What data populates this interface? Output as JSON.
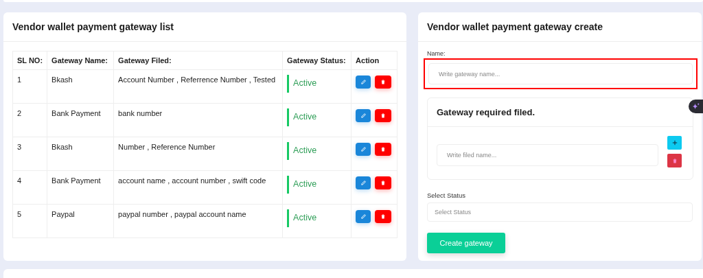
{
  "list_card": {
    "title": "Vendor wallet payment gateway list",
    "table": {
      "columns": [
        "SL NO:",
        "Gateway Name:",
        "Gateway Filed:",
        "Gateway Status:",
        "Action"
      ],
      "rows": [
        {
          "sl": "1",
          "name": "Bkash",
          "fields": "Account Number , Referrence Number , Tested",
          "status": "Active",
          "active": true
        },
        {
          "sl": "2",
          "name": "Bank Payment",
          "fields": "bank number",
          "status": "Active",
          "active": true
        },
        {
          "sl": "3",
          "name": "Bkash",
          "fields": "Number , Reference Number",
          "status": "Active",
          "active": true
        },
        {
          "sl": "4",
          "name": "Bank Payment",
          "fields": "account name , account number , swift code",
          "status": "Active",
          "active": true
        },
        {
          "sl": "5",
          "name": "Paypal",
          "fields": "paypal number , paypal account name",
          "status": "Active",
          "active": true
        }
      ]
    }
  },
  "create_card": {
    "title": "Vendor wallet payment gateway create",
    "name_field": {
      "label": "Name:",
      "placeholder": "Write gateway name...",
      "highlighted": true
    },
    "required_card": {
      "title": "Gateway required filed.",
      "field": {
        "placeholder": "Write filed name..."
      }
    },
    "status_field": {
      "label": "Select Status",
      "placeholder": "Select Status"
    },
    "submit": "Create gateway"
  }
}
